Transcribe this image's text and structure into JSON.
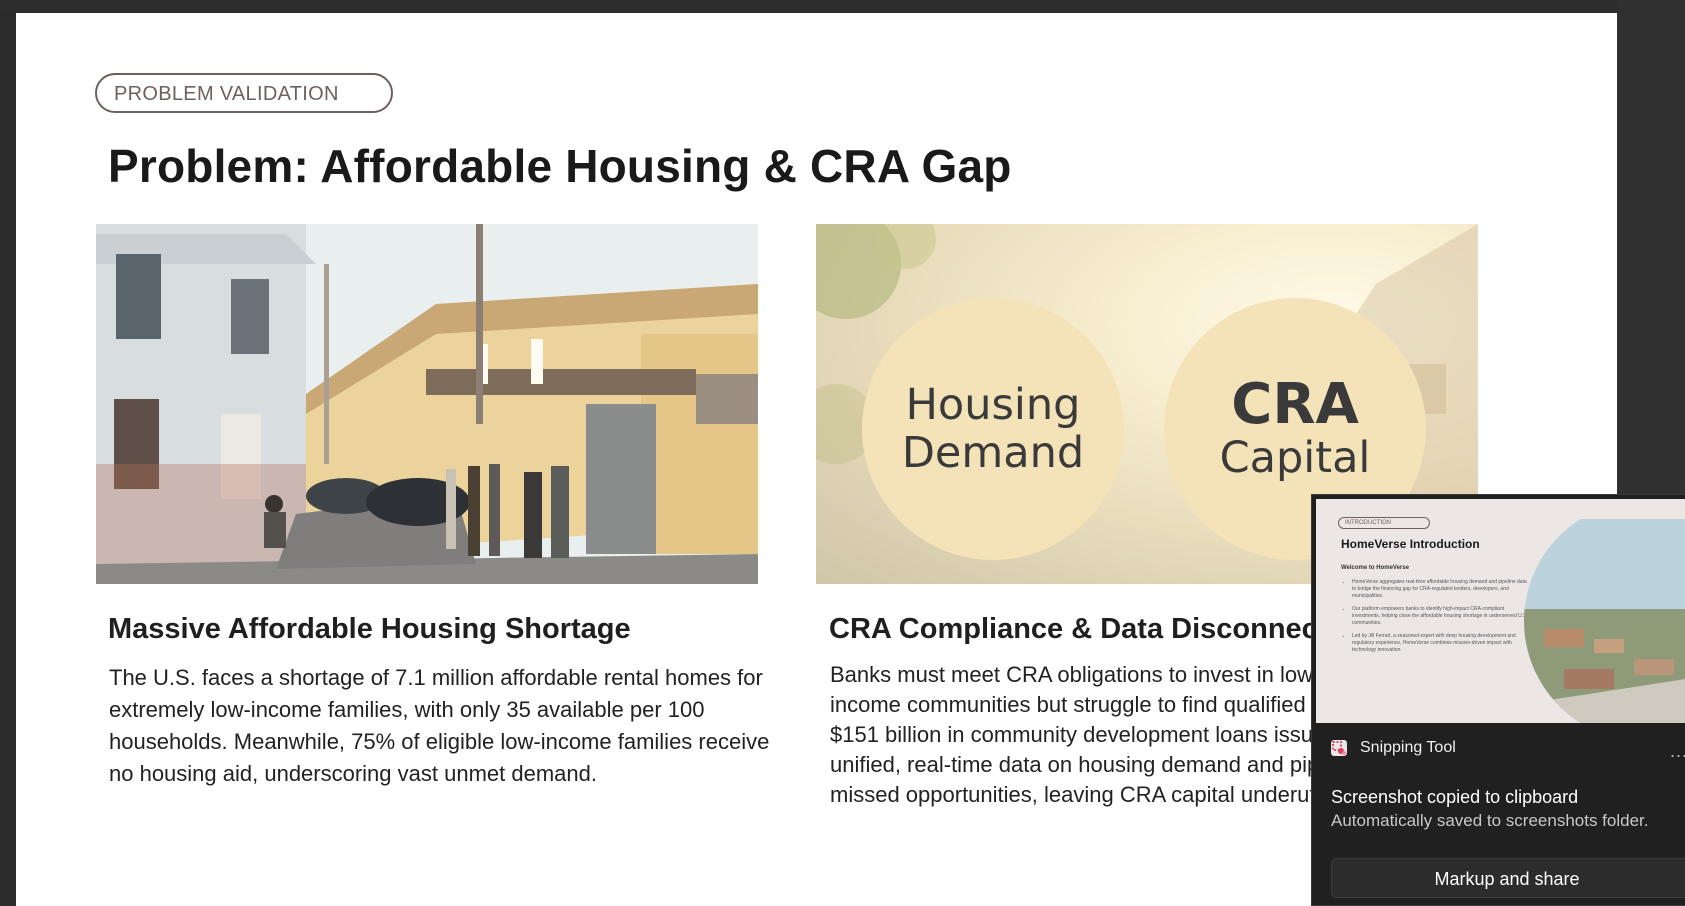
{
  "slide": {
    "badge": "PROBLEM VALIDATION",
    "title": "Problem: Affordable Housing & CRA Gap",
    "circles": {
      "left_line1": "Housing",
      "left_line2": "Demand",
      "right_line1": "CRA",
      "right_line2": "Capital"
    },
    "left": {
      "heading": "Massive Affordable Housing Shortage",
      "body": "The U.S. faces a shortage of 7.1 million affordable rental homes for extremely low-income families, with only 35 available per 100 households. Meanwhile, 75% of eligible low-income families receive no housing aid, underscoring vast unmet demand."
    },
    "right": {
      "heading": "CRA Compliance & Data Disconnect",
      "body": "Banks must meet CRA obligations to invest in low- and moderate-income communities but struggle to find qualified projects. Despite $151 billion in community development loans issued, the lack of unified, real-time data on housing demand and pipelines causes missed opportunities, leaving CRA capital underutilized."
    }
  },
  "toast": {
    "app_name": "Snipping Tool",
    "more": "...",
    "title": "Screenshot copied to clipboard",
    "subtitle": "Automatically saved to screenshots folder.",
    "button": "Markup and share",
    "preview": {
      "badge": "INTRODUCTION",
      "title": "HomeVerse Introduction",
      "subtitle": "Welcome to HomeVerse",
      "bullets": [
        "HomeVerse aggregates real-time affordable housing demand and pipeline data to bridge the financing gap for CRA-regulated lenders, developers, and municipalities.",
        "Our platform empowers banks to identify high-impact CRA-compliant investments, helping close the affordable housing shortage in underserved U.S. communities.",
        "Led by Jill Ferrari, a seasoned expert with deep housing development and regulatory experience, HomeVerse combines mission-driven impact with technology innovation."
      ]
    }
  },
  "colors": {
    "desktop": "#2b2b2b",
    "slide_bg": "#ffffff",
    "badge_border": "#6f6060",
    "circle_fill": "#f4e3b8",
    "toast_bg": "#202020"
  }
}
